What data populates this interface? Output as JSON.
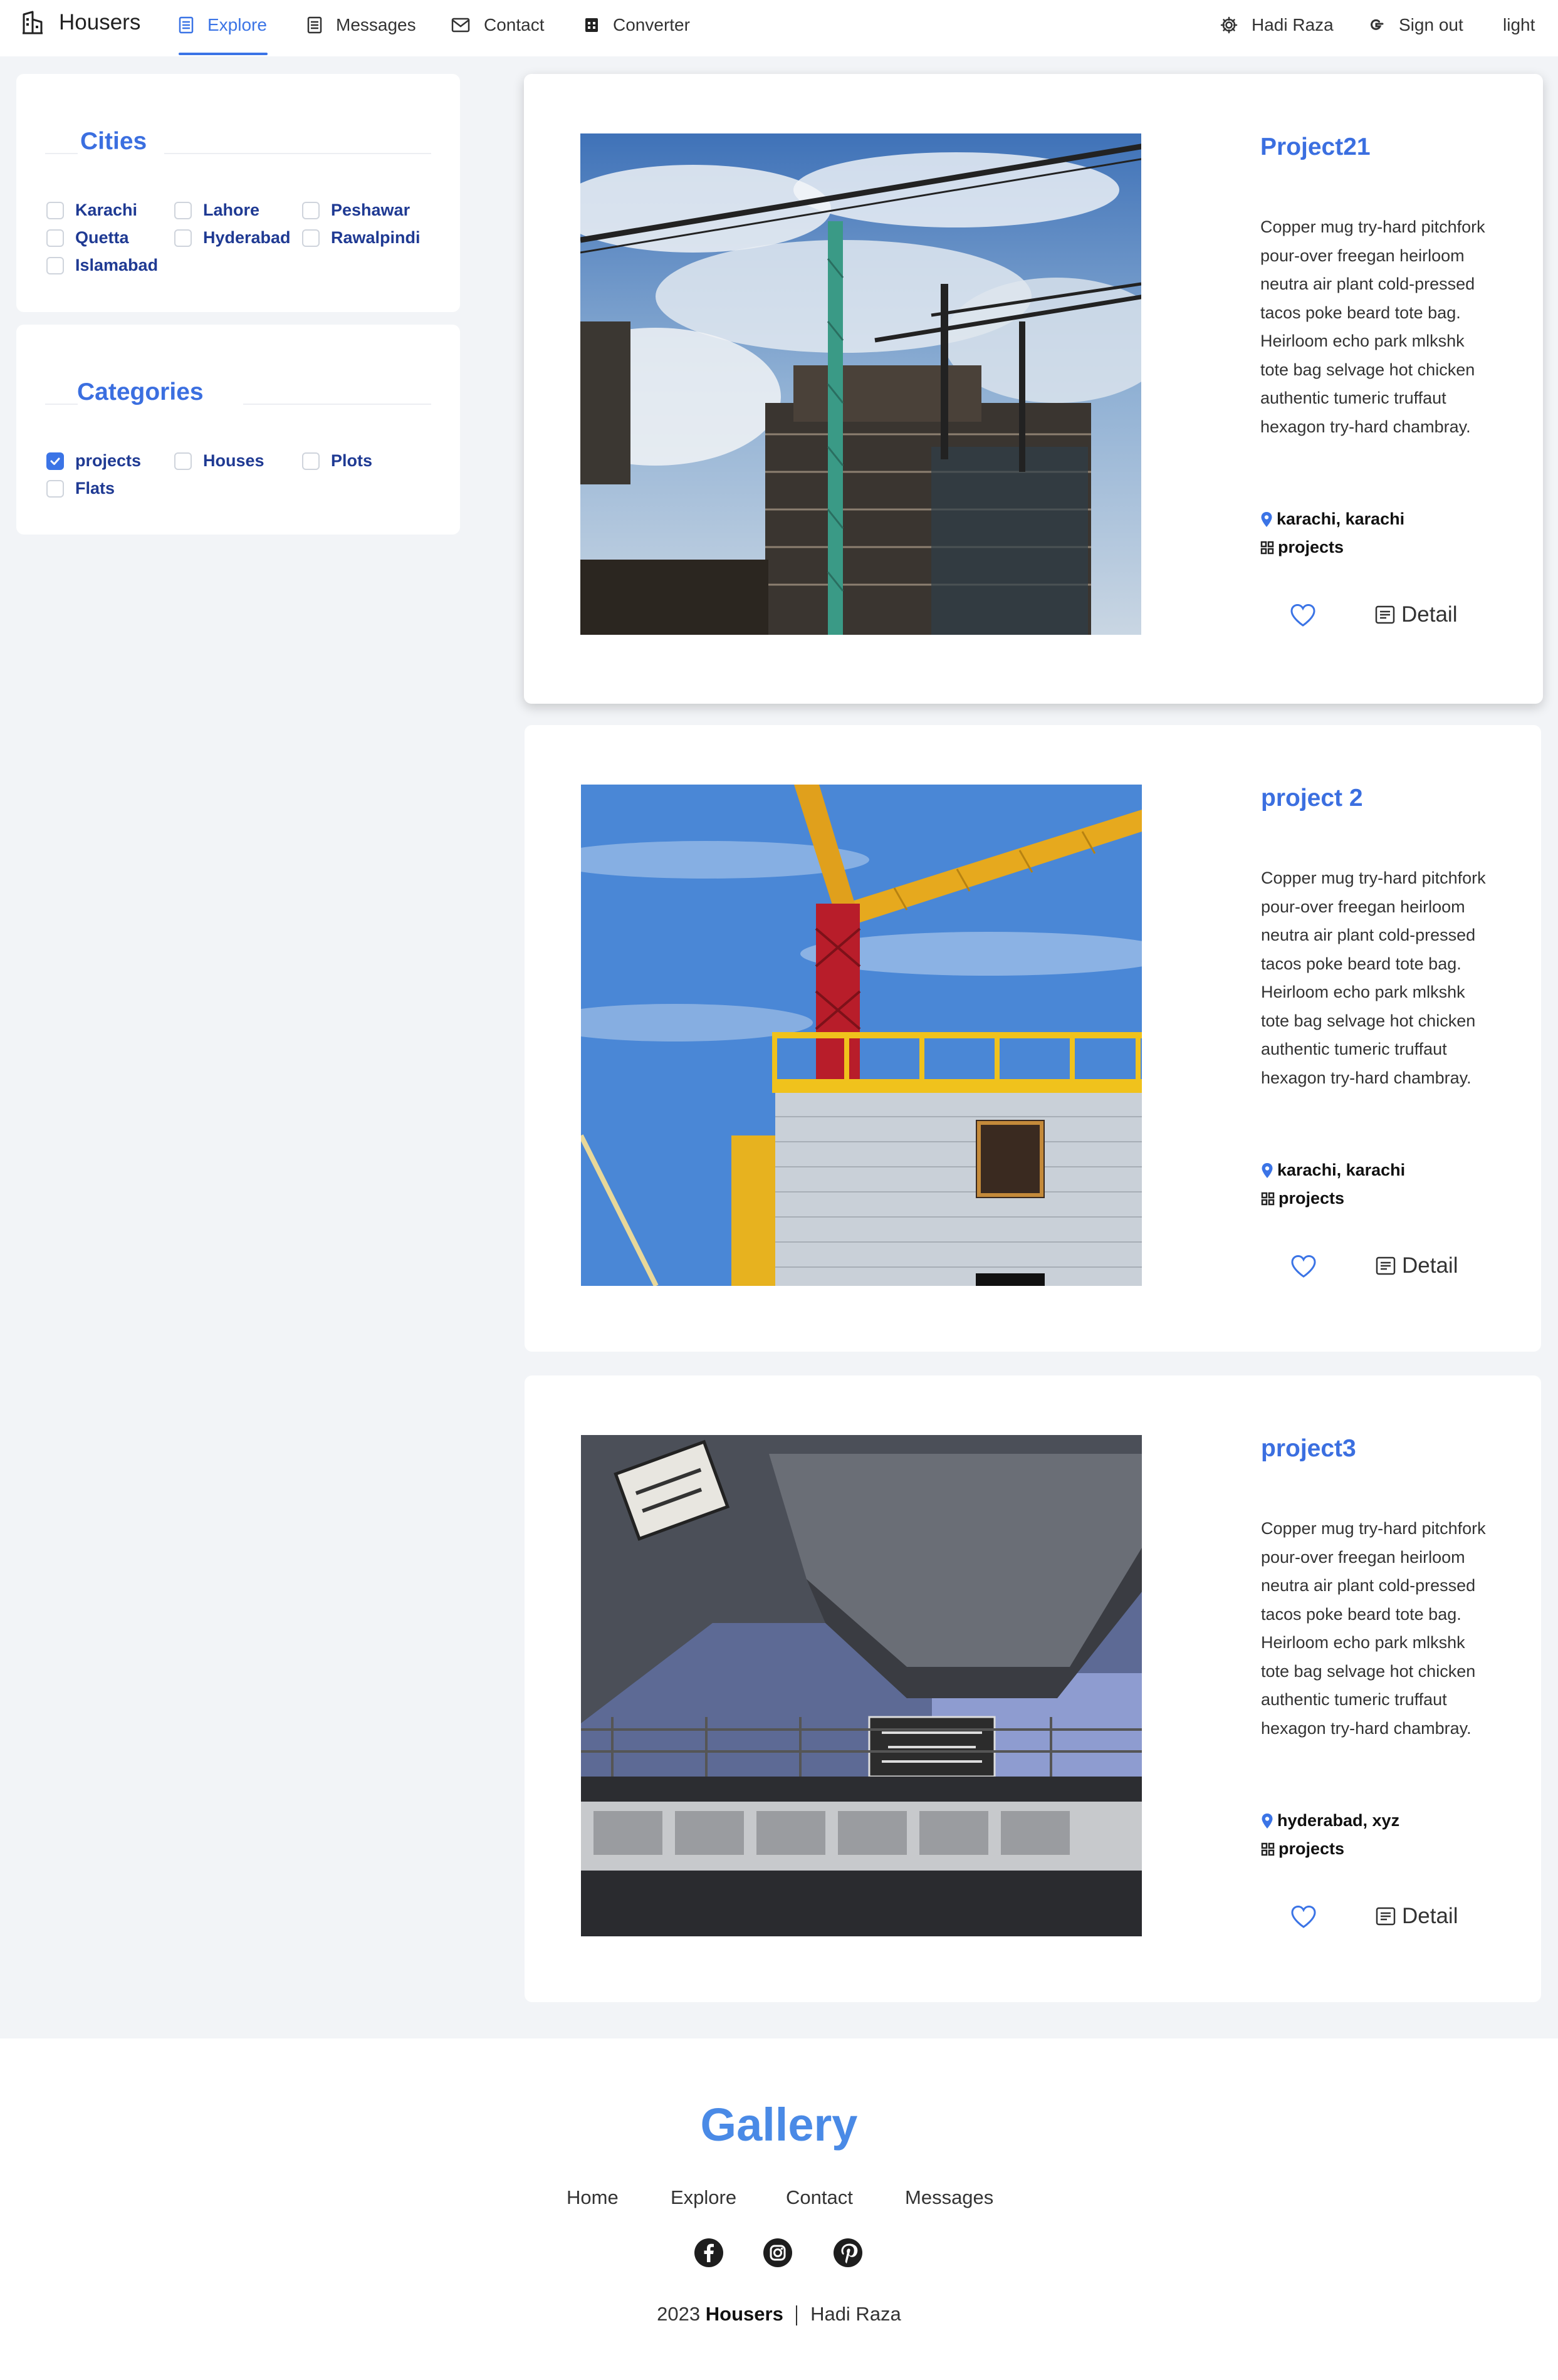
{
  "header": {
    "brand": "Housers",
    "nav": [
      {
        "label": "Explore"
      },
      {
        "label": "Messages"
      },
      {
        "label": "Contact"
      },
      {
        "label": "Converter"
      }
    ],
    "user": "Hadi Raza",
    "signout": "Sign out",
    "theme": "light"
  },
  "sidebar": {
    "cities": {
      "title": "Cities",
      "options": [
        {
          "label": "Karachi",
          "checked": false
        },
        {
          "label": "Lahore",
          "checked": false
        },
        {
          "label": "Peshawar",
          "checked": false
        },
        {
          "label": "Quetta",
          "checked": false
        },
        {
          "label": "Hyderabad",
          "checked": false
        },
        {
          "label": "Rawalpindi",
          "checked": false
        },
        {
          "label": "Islamabad",
          "checked": false
        }
      ]
    },
    "categories": {
      "title": "Categories",
      "options": [
        {
          "label": "projects",
          "checked": true
        },
        {
          "label": "Houses",
          "checked": false
        },
        {
          "label": "Plots",
          "checked": false
        },
        {
          "label": "Flats",
          "checked": false
        }
      ]
    }
  },
  "cards": [
    {
      "title": "Project21",
      "description": "Copper mug try-hard pitchfork pour-over freegan heirloom neutra air plant cold-pressed tacos poke beard tote bag. Heirloom echo park mlkshk tote bag selvage hot chicken authentic tumeric truffaut hexagon try-hard chambray.",
      "location": "karachi, karachi",
      "category": "projects",
      "detail": "Detail"
    },
    {
      "title": "project 2",
      "description": "Copper mug try-hard pitchfork pour-over freegan heirloom neutra air plant cold-pressed tacos poke beard tote bag. Heirloom echo park mlkshk tote bag selvage hot chicken authentic tumeric truffaut hexagon try-hard chambray.",
      "location": "karachi, karachi",
      "category": "projects",
      "detail": "Detail"
    },
    {
      "title": "project3",
      "description": "Copper mug try-hard pitchfork pour-over freegan heirloom neutra air plant cold-pressed tacos poke beard tote bag. Heirloom echo park mlkshk tote bag selvage hot chicken authentic tumeric truffaut hexagon try-hard chambray.",
      "location": "hyderabad, xyz",
      "category": "projects",
      "detail": "Detail"
    }
  ],
  "footer": {
    "title": "Gallery",
    "links": [
      "Home",
      "Explore",
      "Contact",
      "Messages"
    ],
    "social": [
      "facebook-icon",
      "instagram-icon",
      "pinterest-icon"
    ],
    "year": "2023",
    "brand": "Housers",
    "author": "Hadi Raza"
  },
  "colors": {
    "accent": "#3b74e6",
    "title_blue": "#3b6fe0",
    "gallery_blue": "#4a8ae6",
    "page_bg": "#f2f4f7"
  }
}
